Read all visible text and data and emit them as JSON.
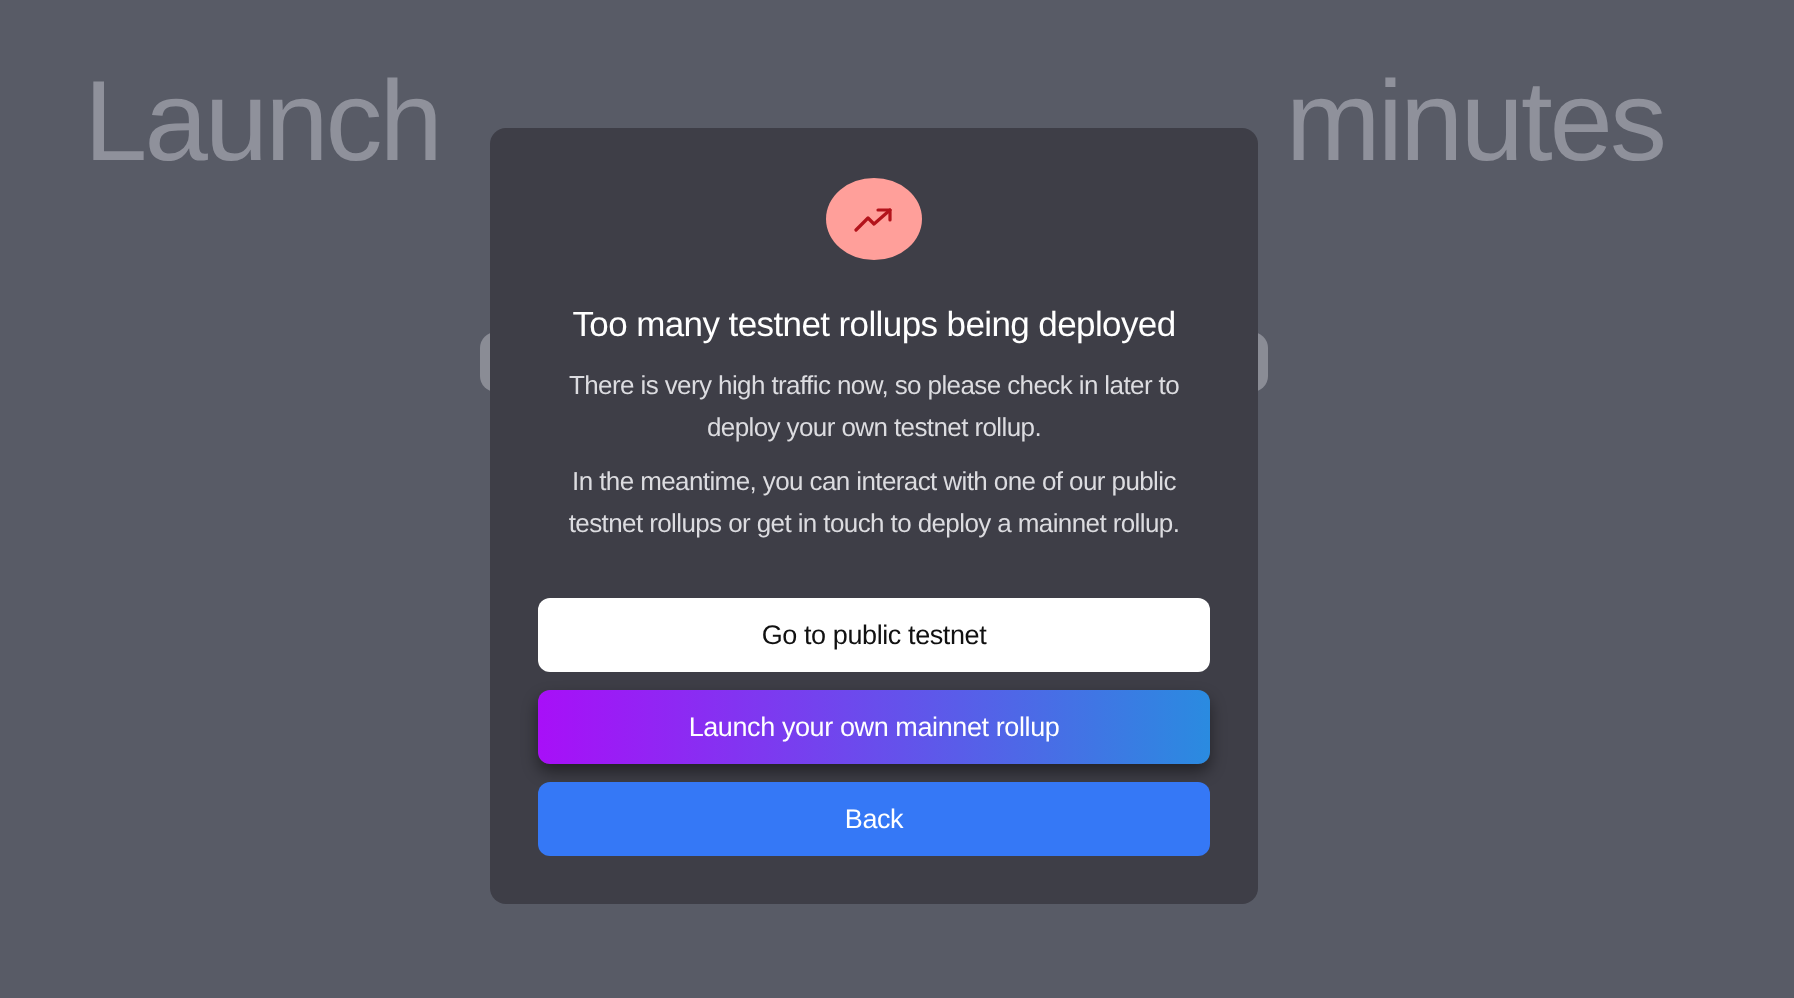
{
  "page": {
    "heading_parts": [
      "Launch",
      "minutes"
    ]
  },
  "dialog": {
    "title": "Too many testnet rollups being deployed",
    "paragraphs": [
      "There is very high traffic now, so please check in later to deploy your own testnet rollup.",
      "In the meantime, you can interact with one of our public testnet rollups or get in touch to deploy a mainnet rollup."
    ],
    "buttons": [
      {
        "label": "Go to public testnet",
        "kind": "secondary"
      },
      {
        "label": "Launch your own mainnet rollup",
        "kind": "gradient"
      },
      {
        "label": "Back",
        "kind": "primary"
      }
    ]
  }
}
